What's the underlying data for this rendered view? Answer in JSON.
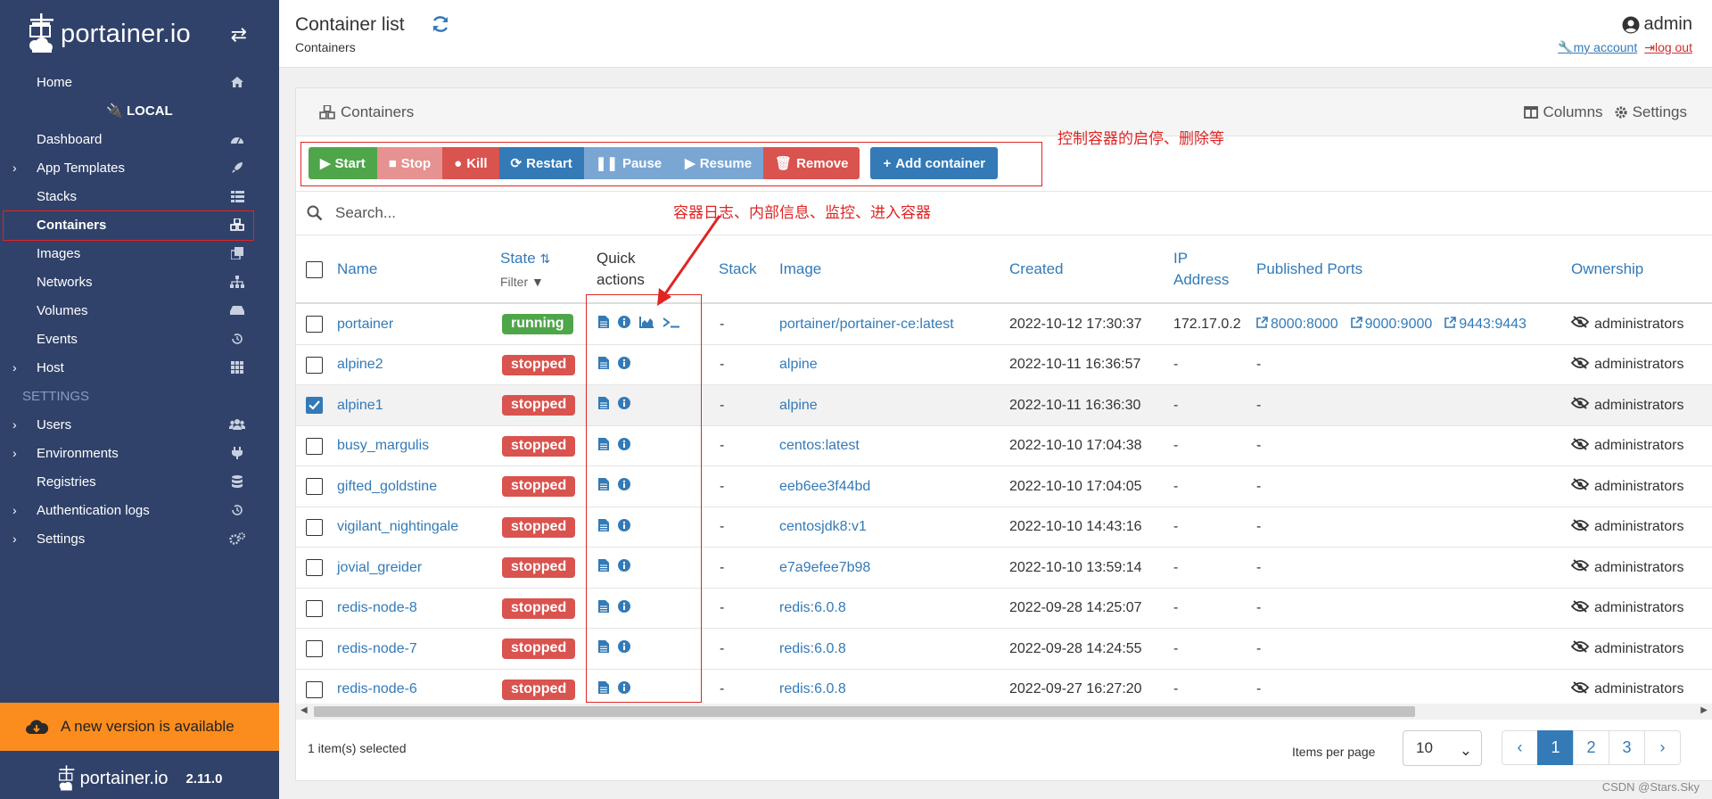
{
  "sidebar": {
    "brand": "portainer.io",
    "items": [
      {
        "label": "Home",
        "icon": "home-icon"
      },
      {
        "label": "LOCAL",
        "icon": "plug-icon"
      },
      {
        "label": "Dashboard",
        "icon": "dashboard-icon"
      },
      {
        "label": "App Templates",
        "icon": "rocket-icon"
      },
      {
        "label": "Stacks",
        "icon": "th-list-icon"
      },
      {
        "label": "Containers",
        "icon": "cubes-icon"
      },
      {
        "label": "Images",
        "icon": "clone-icon"
      },
      {
        "label": "Networks",
        "icon": "sitemap-icon"
      },
      {
        "label": "Volumes",
        "icon": "hdd-icon"
      },
      {
        "label": "Events",
        "icon": "history-icon"
      },
      {
        "label": "Host",
        "icon": "th-icon"
      },
      {
        "label": "SETTINGS"
      },
      {
        "label": "Users",
        "icon": "users-icon"
      },
      {
        "label": "Environments",
        "icon": "plug-icon"
      },
      {
        "label": "Registries",
        "icon": "database-icon"
      },
      {
        "label": "Authentication logs",
        "icon": "history-icon"
      },
      {
        "label": "Settings",
        "icon": "cogs-icon"
      }
    ],
    "new_version": "A new version is available",
    "footer_brand": "portainer.io",
    "version": "2.11.0"
  },
  "header": {
    "title": "Container list",
    "breadcrumb": "Containers",
    "user": "admin",
    "my_account": "my account",
    "log_out": "log out"
  },
  "widget": {
    "title": "Containers",
    "columns_label": "Columns",
    "settings_label": "Settings",
    "buttons": {
      "start": "Start",
      "stop": "Stop",
      "kill": "Kill",
      "restart": "Restart",
      "pause": "Pause",
      "resume": "Resume",
      "remove": "Remove",
      "add": "Add container"
    },
    "search_placeholder": "Search...",
    "annotations": {
      "toolbar_note": "控制容器的启停、删除等",
      "quick_actions_note": "容器日志、内部信息、监控、进入容器"
    },
    "columns": {
      "name": "Name",
      "state": "State",
      "state_filter": "Filter",
      "quick_actions_1": "Quick",
      "quick_actions_2": "actions",
      "stack": "Stack",
      "image": "Image",
      "created": "Created",
      "ip_1": "IP",
      "ip_2": "Address",
      "ports": "Published Ports",
      "ownership": "Ownership"
    },
    "rows": [
      {
        "name": "portainer",
        "state": "running",
        "stack": "-",
        "image": "portainer/portainer-ce:latest",
        "created": "2022-10-12 17:30:37",
        "ip": "172.17.0.2",
        "ports": [
          "8000:8000",
          "9000:9000",
          "9443:9443"
        ],
        "ownership": "administrators",
        "checked": false
      },
      {
        "name": "alpine2",
        "state": "stopped",
        "stack": "-",
        "image": "alpine",
        "created": "2022-10-11 16:36:57",
        "ip": "-",
        "ports": [
          "-"
        ],
        "ownership": "administrators",
        "checked": false
      },
      {
        "name": "alpine1",
        "state": "stopped",
        "stack": "-",
        "image": "alpine",
        "created": "2022-10-11 16:36:30",
        "ip": "-",
        "ports": [
          "-"
        ],
        "ownership": "administrators",
        "checked": true
      },
      {
        "name": "busy_margulis",
        "state": "stopped",
        "stack": "-",
        "image": "centos:latest",
        "created": "2022-10-10 17:04:38",
        "ip": "-",
        "ports": [
          "-"
        ],
        "ownership": "administrators",
        "checked": false
      },
      {
        "name": "gifted_goldstine",
        "state": "stopped",
        "stack": "-",
        "image": "eeb6ee3f44bd",
        "created": "2022-10-10 17:04:05",
        "ip": "-",
        "ports": [
          "-"
        ],
        "ownership": "administrators",
        "checked": false
      },
      {
        "name": "vigilant_nightingale",
        "state": "stopped",
        "stack": "-",
        "image": "centosjdk8:v1",
        "created": "2022-10-10 14:43:16",
        "ip": "-",
        "ports": [
          "-"
        ],
        "ownership": "administrators",
        "checked": false
      },
      {
        "name": "jovial_greider",
        "state": "stopped",
        "stack": "-",
        "image": "e7a9efee7b98",
        "created": "2022-10-10 13:59:14",
        "ip": "-",
        "ports": [
          "-"
        ],
        "ownership": "administrators",
        "checked": false
      },
      {
        "name": "redis-node-8",
        "state": "stopped",
        "stack": "-",
        "image": "redis:6.0.8",
        "created": "2022-09-28 14:25:07",
        "ip": "-",
        "ports": [
          "-"
        ],
        "ownership": "administrators",
        "checked": false
      },
      {
        "name": "redis-node-7",
        "state": "stopped",
        "stack": "-",
        "image": "redis:6.0.8",
        "created": "2022-09-28 14:24:55",
        "ip": "-",
        "ports": [
          "-"
        ],
        "ownership": "administrators",
        "checked": false
      },
      {
        "name": "redis-node-6",
        "state": "stopped",
        "stack": "-",
        "image": "redis:6.0.8",
        "created": "2022-09-27 16:27:20",
        "ip": "-",
        "ports": [
          "-"
        ],
        "ownership": "administrators",
        "checked": false
      }
    ],
    "footer": {
      "selected": "1 item(s) selected",
      "items_per_page": "Items per page",
      "page_size": "10",
      "pages": [
        "‹",
        "1",
        "2",
        "3",
        "›"
      ],
      "current_page": "1"
    }
  },
  "watermark": "CSDN @Stars.Sky",
  "colors": {
    "sidebar": "#30426a",
    "primary": "#337ab7",
    "success": "#4fa64a",
    "danger": "#d9534f",
    "warning": "#fb8c1e",
    "annotation": "#e02424"
  }
}
